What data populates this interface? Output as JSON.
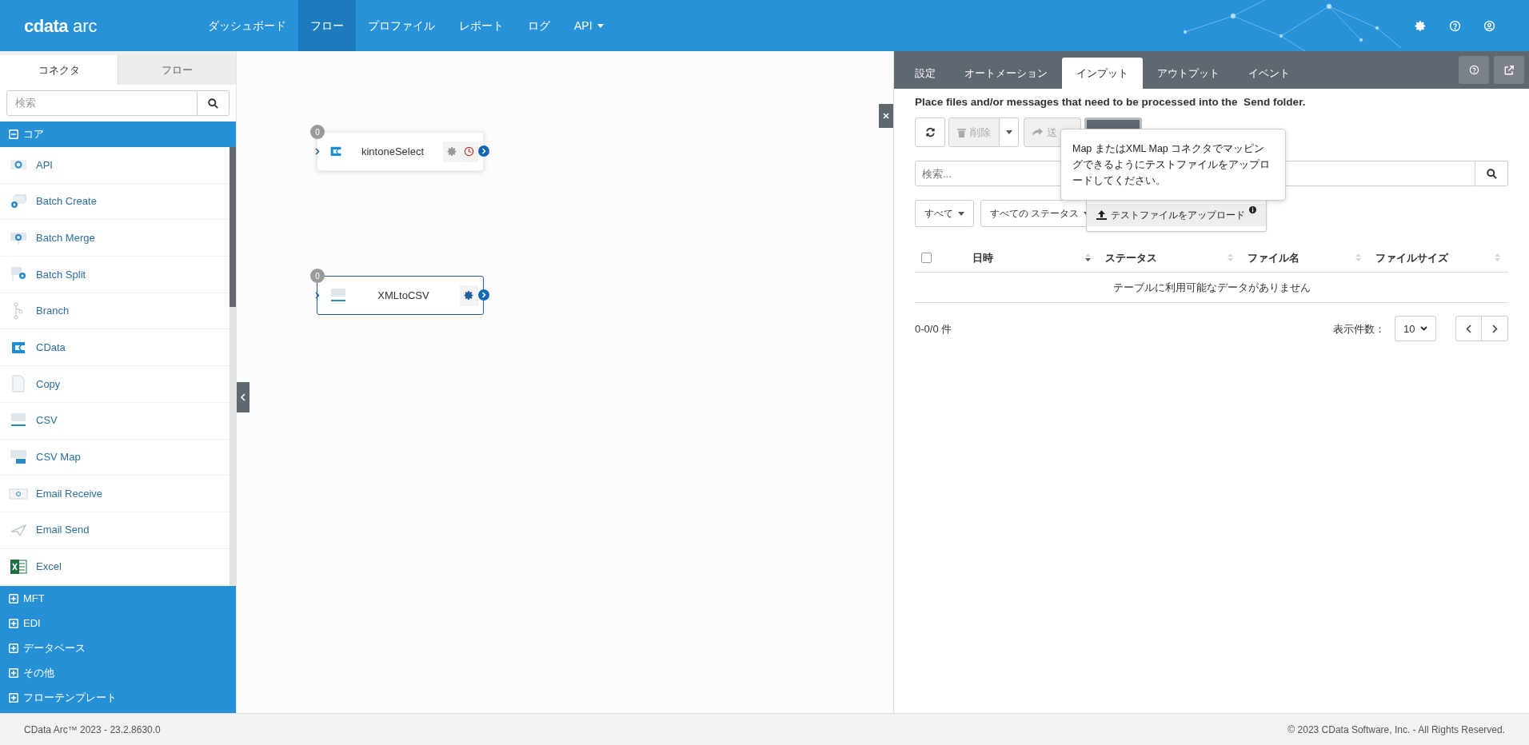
{
  "header": {
    "logo": {
      "brand": "cdata",
      "product": "arc"
    },
    "nav": [
      {
        "label": "ダッシュボード",
        "selected": false,
        "has_menu": false
      },
      {
        "label": "フロー",
        "selected": true,
        "has_menu": false
      },
      {
        "label": "プロファイル",
        "selected": false,
        "has_menu": false
      },
      {
        "label": "レポート",
        "selected": false,
        "has_menu": false
      },
      {
        "label": "ログ",
        "selected": false,
        "has_menu": false
      },
      {
        "label": "API",
        "selected": false,
        "has_menu": true
      }
    ]
  },
  "sidebar": {
    "tabs": [
      {
        "label": "コネクタ",
        "selected": true
      },
      {
        "label": "フロー",
        "selected": false
      }
    ],
    "search": {
      "placeholder": "検索"
    },
    "categories": [
      {
        "label": "コア",
        "expanded": true,
        "items": [
          "API",
          "Batch Create",
          "Batch Merge",
          "Batch Split",
          "Branch",
          "CData",
          "Copy",
          "CSV",
          "CSV Map",
          "Email Receive",
          "Email Send",
          "Excel"
        ]
      },
      {
        "label": "MFT",
        "expanded": false
      },
      {
        "label": "EDI",
        "expanded": false
      },
      {
        "label": "データベース",
        "expanded": false
      },
      {
        "label": "その他",
        "expanded": false
      },
      {
        "label": "フローテンプレート",
        "expanded": false
      }
    ]
  },
  "canvas": {
    "nodes": [
      {
        "name": "kintoneSelect",
        "count": "0",
        "selected": false,
        "scheduled": true
      },
      {
        "name": "XMLtoCSV",
        "count": "0",
        "selected": true,
        "scheduled": false
      }
    ]
  },
  "panel": {
    "tabs": [
      {
        "label": "設定",
        "selected": false
      },
      {
        "label": "オートメーション",
        "selected": false
      },
      {
        "label": "インプット",
        "selected": true
      },
      {
        "label": "アウトプット",
        "selected": false
      },
      {
        "label": "イベント",
        "selected": false
      }
    ],
    "description": "Place files and/or messages that need to be processed into the  Send folder.",
    "toolbar": {
      "delete": "削除",
      "send": "送"
    },
    "tooltip": "Map またはXML Map コネクタでマッピングできるようにテストファイルをアップロードしてください。",
    "upload_item": "テストファイルをアップロード",
    "search": {
      "placeholder": "検索..."
    },
    "filters": [
      "すべて",
      "すべての ステータス"
    ],
    "table": {
      "select_all": {
        "checked": false
      },
      "columns": [
        {
          "label": "日時",
          "sorted": true
        },
        {
          "label": "ステータス",
          "sorted": false
        },
        {
          "label": "ファイル名",
          "sorted": false
        },
        {
          "label": "ファイルサイズ",
          "sorted": false
        }
      ],
      "empty": "テーブルに利用可能なデータがありません"
    },
    "count": "0-0/0 件",
    "page_size_label": "表示件数：",
    "page_size": "10"
  },
  "footer": {
    "version": "CData Arc™ 2023 - 23.2.8630.0",
    "copyright": "© 2023 CData Software, Inc. - All Rights Reserved."
  }
}
